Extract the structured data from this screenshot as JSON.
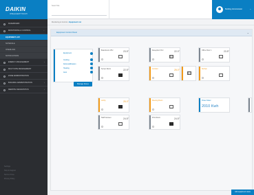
{
  "brand": {
    "name": "DAIKIN",
    "tagline": "INTELLIGENT TOUCH",
    "color": "#0a7fc3"
  },
  "sidebar": {
    "items": [
      {
        "label": "Dashboard",
        "expandable": false
      },
      {
        "label": "Monitoring & Control",
        "expandable": true,
        "children": [
          {
            "label": "Equipment List",
            "active": true
          },
          {
            "label": "Schedule",
            "active": false
          },
          {
            "label": "Interlock",
            "active": false
          },
          {
            "label": "Notifications",
            "active": false
          }
        ]
      },
      {
        "label": "Energy Management",
        "expandable": true
      },
      {
        "label": "Multi Site Management",
        "expandable": false
      },
      {
        "label": "Zone Administration",
        "expandable": false
      },
      {
        "label": "Building Administration",
        "expandable": true
      },
      {
        "label": "Remote Diagnostics",
        "expandable": true
      }
    ],
    "footer": [
      "Settings",
      "Help & Support",
      "Terms of Use",
      "Privacy Policy"
    ]
  },
  "topbar": {
    "site_label": "Select Site",
    "site_value": "",
    "user_name": "Building Administrator"
  },
  "breadcrumb": {
    "parent": "Monitoring & Control",
    "current": "Equipment List"
  },
  "panel": {
    "title": "Equipment Control Panel"
  },
  "filter": {
    "rows": [
      "Equipment",
      "Cooling",
      "Dehumidification",
      "Heating",
      "Auto"
    ],
    "button": "Manage Zones"
  },
  "tiles": [
    {
      "name": "Boardroom AHU",
      "temp": "23.5°",
      "status": "normal",
      "unit": "light"
    },
    {
      "name": "Reception FCU",
      "temp": "22.0°",
      "status": "normal",
      "unit": "vent"
    },
    {
      "name": "Office Floor 1",
      "temp": "23.5°",
      "status": "normal",
      "unit": "light"
    },
    {
      "name": "Server Room",
      "temp": "22.5°",
      "status": "normal",
      "unit": "dark"
    },
    {
      "name": "Corridor",
      "temp": "25.0°",
      "status": "alert",
      "unit": "light"
    },
    {
      "name": "",
      "temp": "",
      "status": "alert",
      "unit": "vent"
    },
    {
      "name": "Kitchen",
      "temp": "",
      "status": "alert",
      "unit": "light"
    },
    {
      "name": "Lobby",
      "temp": "25.0°",
      "status": "alert",
      "unit": "light"
    },
    {
      "name": "Meeting Room",
      "temp": "",
      "status": "alert",
      "unit": "light"
    },
    {
      "name": "Power Meter",
      "power": "2010 Kwh",
      "status": "meter",
      "unit": "none"
    },
    {
      "name": "Staff Canteen",
      "temp": "24.5°",
      "status": "normal",
      "unit": "light"
    },
    {
      "name": "Print Room",
      "temp": "24.5°",
      "status": "normal",
      "unit": "dark"
    }
  ],
  "actions": {
    "add_equipment": "Add equipment views"
  },
  "colors": {
    "alert": "#f19a1a",
    "normal": "#7d8690",
    "meter": "#0a7fc3"
  }
}
